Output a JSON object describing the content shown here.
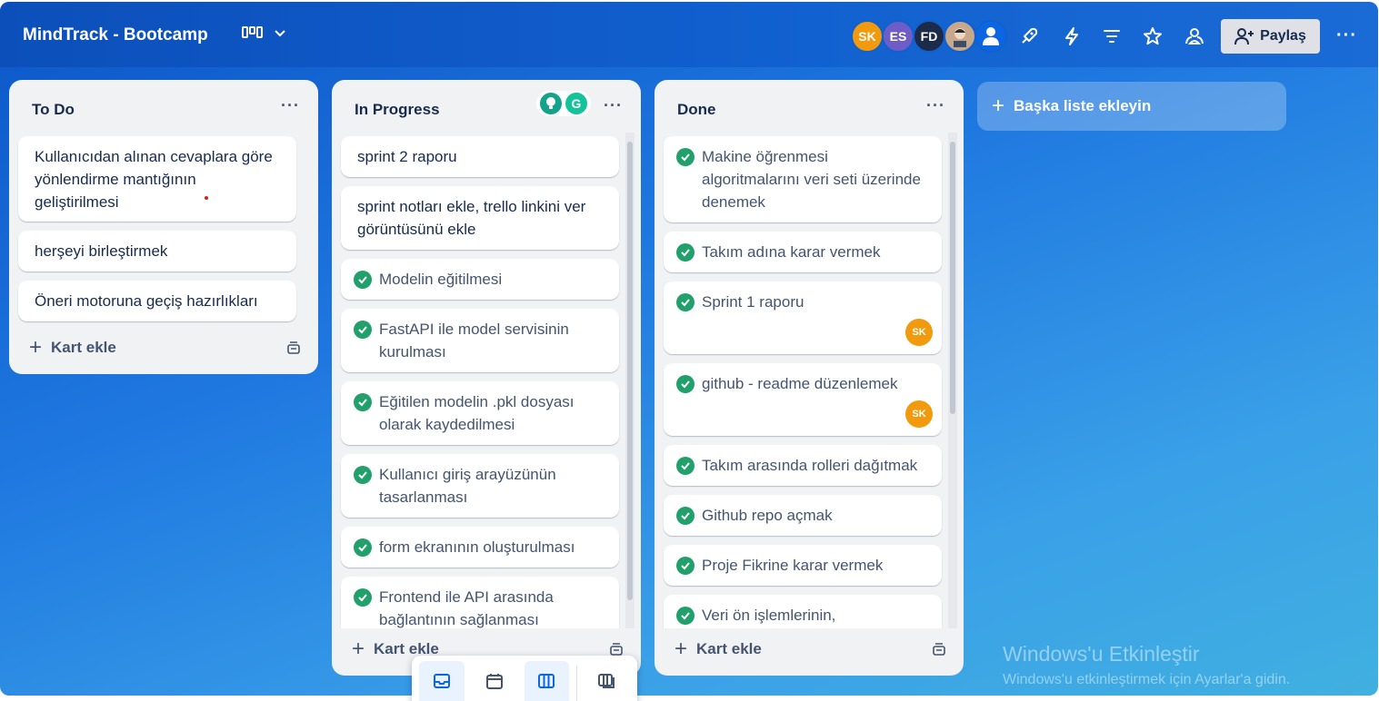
{
  "header": {
    "board_title": "MindTrack - Bootcamp",
    "share_label": "Paylaş",
    "avatars": [
      {
        "initials": "SK",
        "color": "#f29a0d"
      },
      {
        "initials": "ES",
        "color": "#6e5dc6"
      },
      {
        "initials": "FD",
        "color": "#1d2b4a"
      },
      {
        "initials": "",
        "color": "#c7a88c"
      },
      {
        "initials": "",
        "color": "#0c66e4"
      }
    ]
  },
  "lists": [
    {
      "title": "To Do",
      "add_label": "Kart ekle",
      "cards": [
        "Kullanıcıdan alınan cevaplara göre yönlendirme mantığının geliştirilmesi",
        "herşeyi birleştirmek",
        "Öneri motoruna geçiş hazırlıkları"
      ]
    },
    {
      "title": "In Progress",
      "add_label": "Kart ekle",
      "cards": [
        "sprint 2 raporu",
        "sprint notları ekle, trello linkini ver görüntüsünü ekle",
        "Modelin eğitilmesi",
        "FastAPI ile model servisinin kurulması",
        "Eğitilen modelin .pkl dosyası olarak kaydedilmesi",
        "Kullanıcı giriş arayüzünün tasarlanması",
        "form ekranının oluşturulması",
        "Frontend ile API arasında bağlantının sağlanması"
      ]
    },
    {
      "title": "Done",
      "add_label": "Kart ekle",
      "cards": [
        "Makine öğrenmesi algoritmalarını veri seti üzerinde denemek",
        "Takım adına karar vermek",
        "Sprint 1 raporu",
        "github - readme düzenlemek",
        "Takım arasında rolleri dağıtmak",
        "Github repo açmak",
        "Proje Fikrine karar vermek",
        "Veri ön işlemlerinin,"
      ],
      "card_avatar": "SK"
    }
  ],
  "add_list_label": "Başka liste ekleyin",
  "watermark": {
    "title": "Windows'u Etkinleştir",
    "subtitle": "Windows'u etkinleştirmek için Ayarlar'a gidin."
  },
  "colors": {
    "check": "#22a06b",
    "accent": "#0c66e4"
  }
}
